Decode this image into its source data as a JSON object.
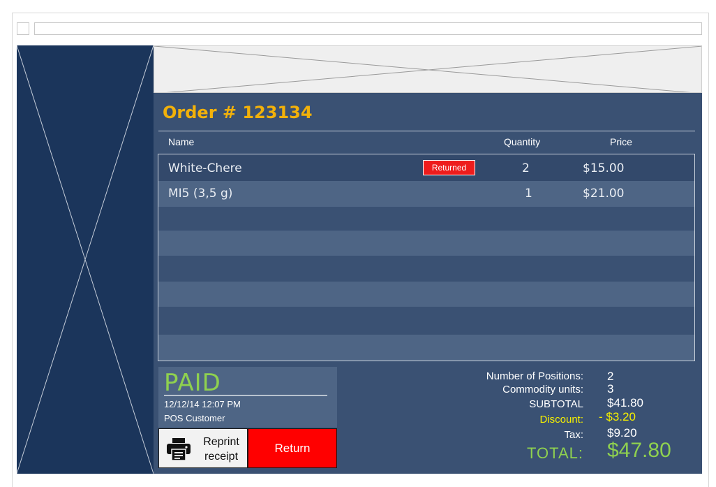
{
  "colors": {
    "sidebar_bg": "#1b355b",
    "main_bg": "#3a5173",
    "accent_title": "#f2b10a",
    "returned_badge": "#ee1c1c",
    "return_button": "#ff0000",
    "paid_green": "#8fd14f",
    "discount_yellow": "#f6f000"
  },
  "order": {
    "title": "Order # 123134"
  },
  "table": {
    "headers": {
      "name": "Name",
      "quantity": "Quantity",
      "price": "Price"
    },
    "rows": [
      {
        "name": "White-Chere",
        "badge": "Returned",
        "quantity": "2",
        "price": "$15.00"
      },
      {
        "name": "MI5 (3,5 g)",
        "badge": "",
        "quantity": "1",
        "price": "$21.00"
      }
    ]
  },
  "status": {
    "label": "PAID",
    "date": "12/12/14  12:07 PM",
    "customer": "POS Customer"
  },
  "actions": {
    "reprint_label_line1": "Reprint",
    "reprint_label_line2": "receipt",
    "reprint_icon": "printer-icon",
    "return_label": "Return"
  },
  "summary": {
    "positions_label": "Number of Positions:",
    "positions_value": "2",
    "units_label": "Commodity units:",
    "units_value": "3",
    "subtotal_label": "SUBTOTAL",
    "subtotal_value": "$41.80",
    "discount_label": "Discount:",
    "discount_value": "- $3.20",
    "tax_label": "Tax:",
    "tax_value": "$9.20",
    "total_label": "TOTAL:",
    "total_value": "$47.80"
  }
}
